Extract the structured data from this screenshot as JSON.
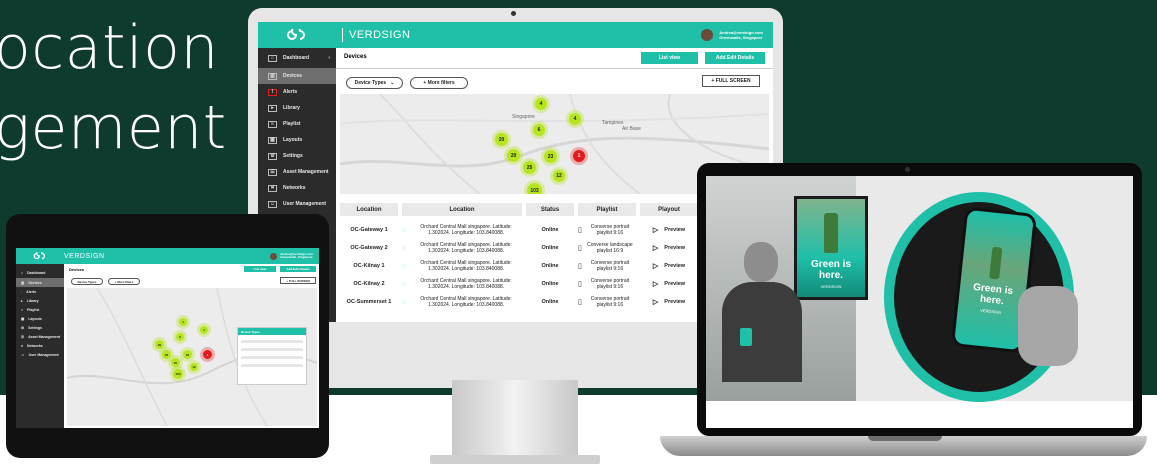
{
  "hero": {
    "line1": "ocation",
    "line2": "gement"
  },
  "app": {
    "brand": "VERDSIGN",
    "user_email": "Andrea@verdsign.com",
    "user_org": "Greenwalls, Singapore"
  },
  "sidebar": {
    "header": "Dashboard",
    "items": [
      {
        "label": "Devices",
        "icon": "chart-icon"
      },
      {
        "label": "Alerts",
        "icon": "bell-icon"
      },
      {
        "label": "Library",
        "icon": "play-icon"
      },
      {
        "label": "Playlist",
        "icon": "playlist-icon"
      },
      {
        "label": "Layouts",
        "icon": "grid-icon"
      },
      {
        "label": "Settings",
        "icon": "gear-icon"
      },
      {
        "label": "Asset Management",
        "icon": "list-icon"
      },
      {
        "label": "Networks",
        "icon": "network-icon"
      },
      {
        "label": "User Management",
        "icon": "users-icon"
      }
    ]
  },
  "devices_page": {
    "title": "Devices",
    "list_view": "List view",
    "add_edit": "Add Edit Details",
    "filter_device_types": "Device Types",
    "more_filters": "+ More filters",
    "full_screen": "+ FULL SCREEN"
  },
  "map": {
    "clusters": [
      4,
      4,
      6,
      20,
      20,
      23,
      25,
      1,
      12,
      103
    ],
    "labels": [
      "Singapore",
      "Tampines",
      "Air Base"
    ]
  },
  "table": {
    "headers": [
      "Location",
      "Location",
      "Status",
      "Playlist",
      "Playout"
    ],
    "rows": [
      {
        "name": "OC-Gateway 1",
        "address": "Orchard Central Mall singapore. Latitude: 1.302024. Longitude: 103.840088.",
        "status": "Online",
        "playlist": "Converse portrait playlist 9:16",
        "playout": "Preview"
      },
      {
        "name": "OC-Gateway 2",
        "address": "Orchard Central Mall singapore. Latitude: 1.302024. Longitude: 103.840088.",
        "status": "Online",
        "playlist": "Converse landscape playlist 16:9",
        "playout": "Preview"
      },
      {
        "name": "OC-Kilnay 1",
        "address": "Orchard Central Mall singapore. Latitude: 1.302024. Longitude: 103.840088.",
        "status": "Online",
        "playlist": "Converse portrait playlist 9:16",
        "playout": "Preview"
      },
      {
        "name": "OC-Kilnay 2",
        "address": "Orchard Central Mall singapore. Latitude: 1.302024. Longitude: 103.840088.",
        "status": "Online",
        "playlist": "Converse portrait playlist 9:16",
        "playout": "Preview"
      },
      {
        "name": "OC-Summerset 1",
        "address": "Orchard Central Mall singapore. Latitude: 1.302024. Longitude: 103.840088.",
        "status": "Online",
        "playlist": "Converse portrait playlist 9:16",
        "playout": "Preview"
      }
    ]
  },
  "tablet_panel": {
    "title": "Device Types"
  },
  "laptop": {
    "billboard_text": "Green is here.",
    "phone_text": "Green is here.",
    "brand": "VERDSIGN"
  },
  "colors": {
    "hero_bg": "#0f3a2e",
    "accent": "#1fbfa8",
    "cluster": "#b6e51e",
    "alert": "#e31b1b"
  }
}
